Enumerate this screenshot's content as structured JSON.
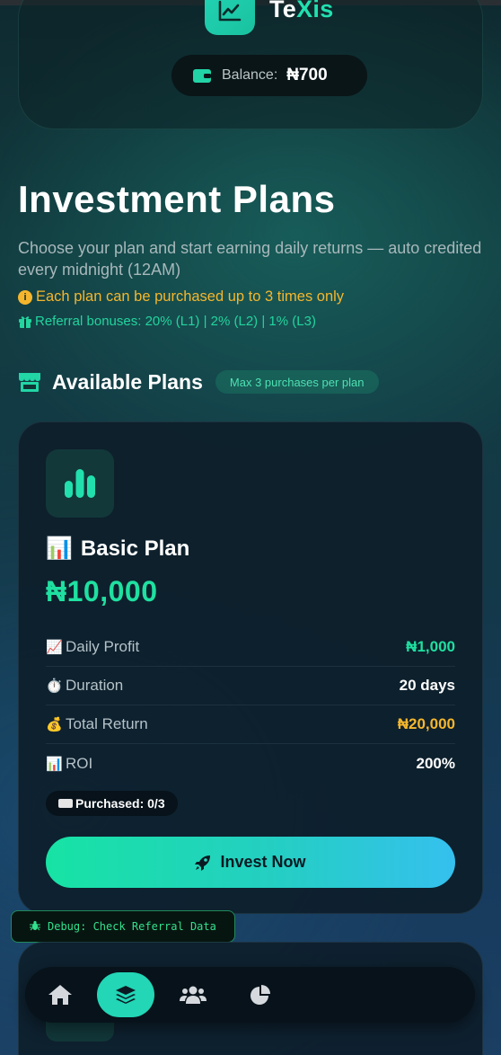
{
  "header": {
    "logo_text_main": "Te",
    "logo_text_accent": "Xis",
    "balance_label": "Balance:",
    "balance_value": "₦700"
  },
  "page": {
    "title": "Investment Plans",
    "subtitle": "Choose your plan and start earning daily returns — auto credited every midnight (12AM)",
    "purchase_limit_note": "Each plan can be purchased up to 3 times only",
    "referral_note": "Referral bonuses: 20% (L1) | 2% (L2) | 1% (L3)"
  },
  "section": {
    "title": "Available Plans",
    "badge": "Max 3 purchases per plan"
  },
  "plan": {
    "name": "Basic Plan",
    "price": "₦10,000",
    "rows": [
      {
        "label": "Daily Profit",
        "value": "₦1,000",
        "icon": "📈"
      },
      {
        "label": "Duration",
        "value": "20 days",
        "icon": "⏱️"
      },
      {
        "label": "Total Return",
        "value": "₦20,000",
        "icon": "💰"
      },
      {
        "label": "ROI",
        "value": "200%",
        "icon": "📊"
      }
    ],
    "purchased": "Purchased: 0/3",
    "invest_label": "Invest Now"
  },
  "debug": {
    "label": "Debug: Check Referral Data"
  },
  "nav": {
    "items": [
      "home-icon",
      "layers-icon",
      "users-icon",
      "pie-chart-icon"
    ],
    "active_index": 1
  },
  "colors": {
    "accent": "#1fe0a0",
    "warning": "#f5b62d",
    "button_gradient_end": "#35c0ee"
  }
}
